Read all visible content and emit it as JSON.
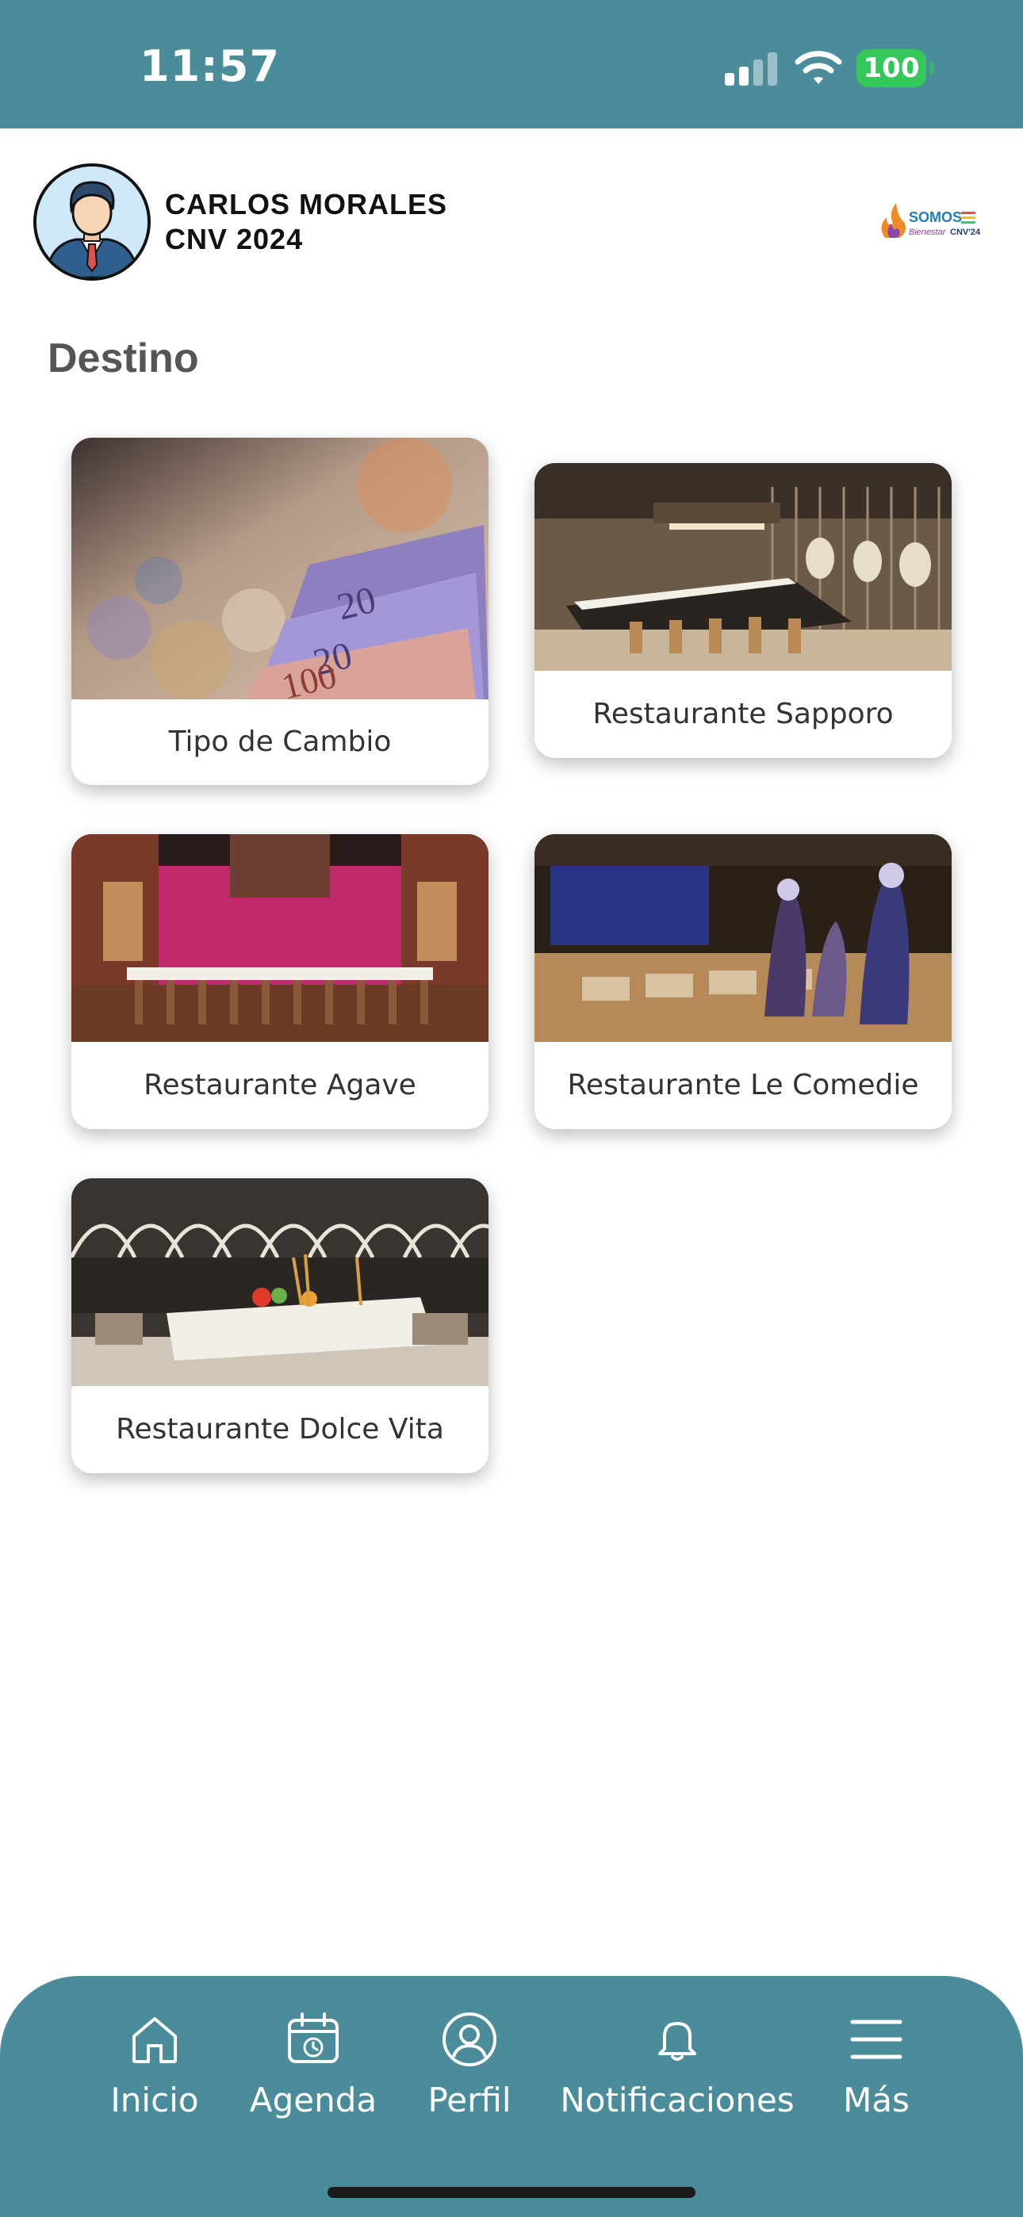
{
  "status_bar": {
    "time": "11:57",
    "battery": "100",
    "icons": [
      "signal-icon",
      "wifi-icon",
      "battery-icon"
    ]
  },
  "header": {
    "user_name": "CARLOS MORALES",
    "event": "CNV 2024",
    "logo_text": "SOMOS",
    "logo_subtext": "CNV'24"
  },
  "page": {
    "title": "Destino"
  },
  "cards": [
    {
      "label": "Tipo de Cambio",
      "image": "currency-banknotes-image"
    },
    {
      "label": "Restaurante Sapporo",
      "image": "sapporo-restaurant-image"
    },
    {
      "label": "Restaurante Agave",
      "image": "agave-restaurant-image"
    },
    {
      "label": "Restaurante Le Comedie",
      "image": "le-comedie-restaurant-image"
    },
    {
      "label": "Restaurante Dolce Vita",
      "image": "dolce-vita-restaurant-image"
    }
  ],
  "nav": {
    "items": [
      {
        "label": "Inicio",
        "icon": "home-icon"
      },
      {
        "label": "Agenda",
        "icon": "calendar-icon"
      },
      {
        "label": "Perfil",
        "icon": "user-icon"
      },
      {
        "label": "Notificaciones",
        "icon": "bell-icon"
      },
      {
        "label": "Más",
        "icon": "menu-icon"
      }
    ]
  },
  "colors": {
    "primary": "#4a8c99",
    "battery": "#34c759",
    "title_text": "#555555"
  }
}
